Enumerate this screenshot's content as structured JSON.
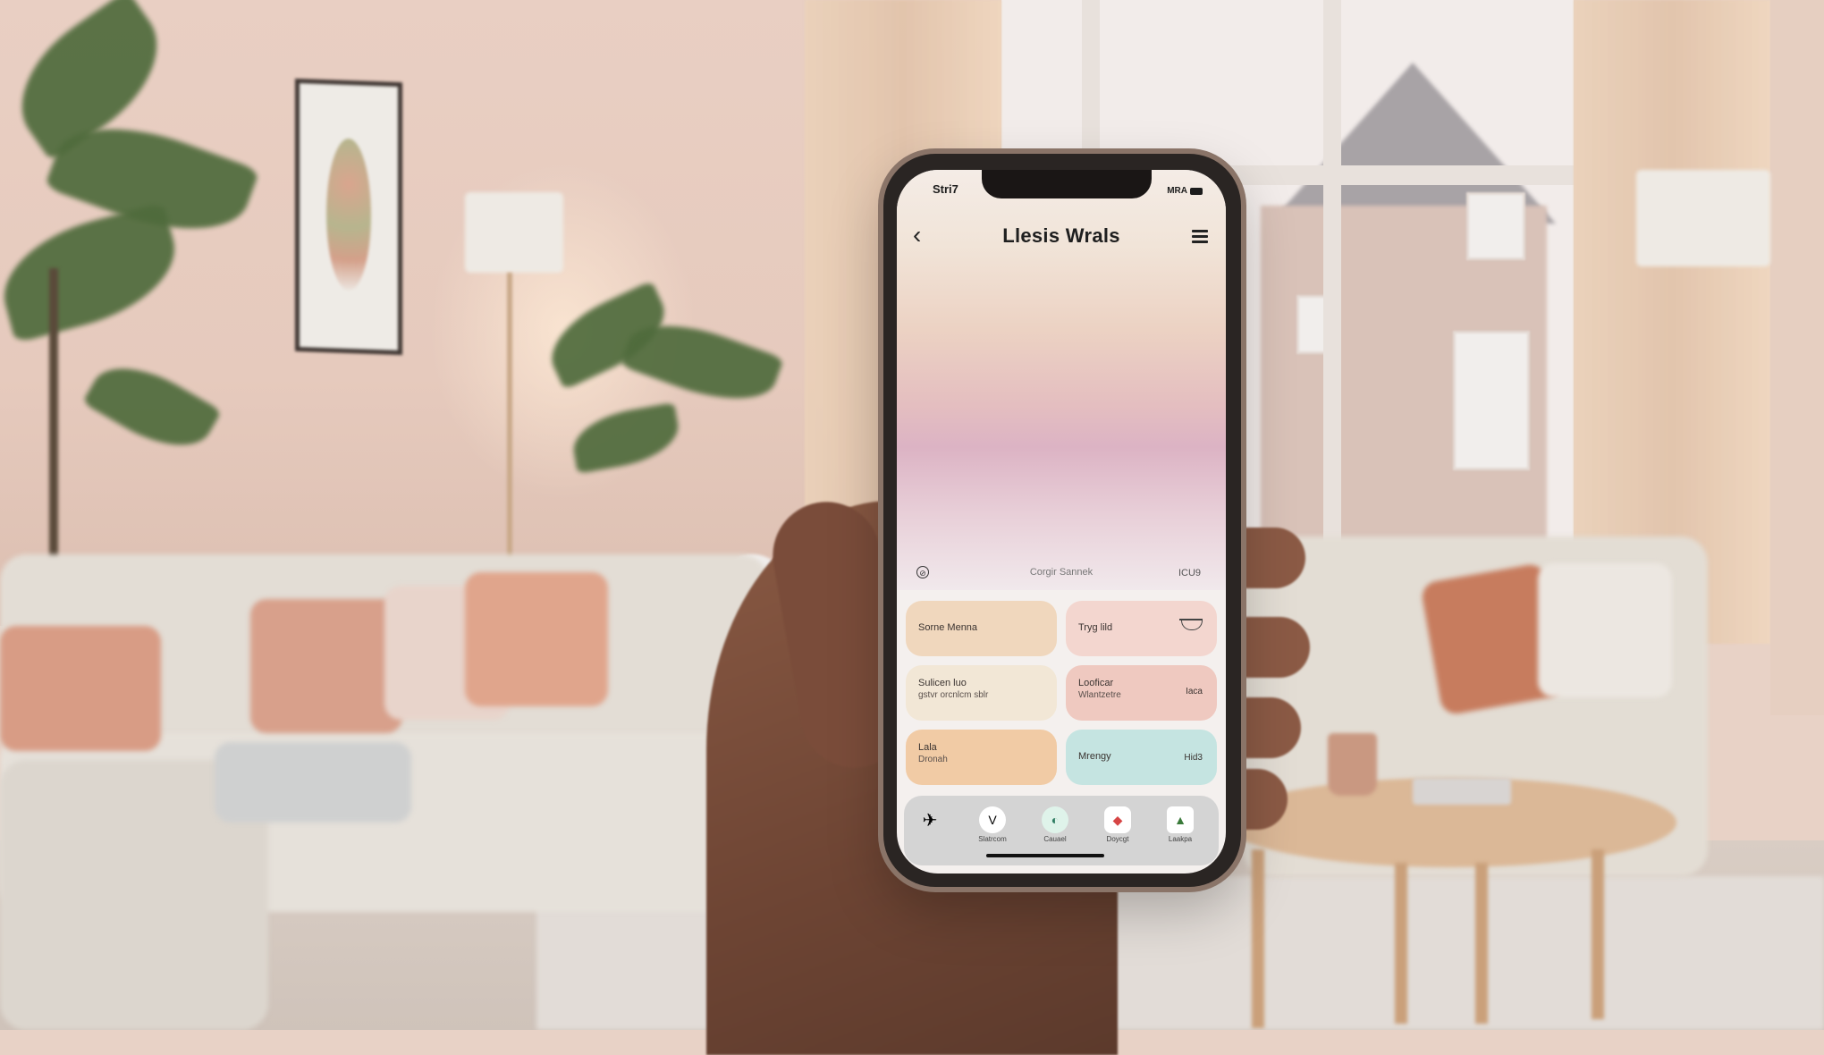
{
  "scene": {
    "description": "Hand holding smartphone in a pastel living room",
    "colors": {
      "wall": "#e8cfc3",
      "phone_frame": "#2a2523",
      "accent_pink": "#dcb3c4",
      "accent_peach": "#f0d4b8"
    }
  },
  "phone": {
    "status_bar": {
      "time": "Stri7",
      "right_text": "MRA",
      "battery_icon": "battery-icon"
    },
    "header": {
      "back_icon": "chevron-left-icon",
      "back_glyph": "‹",
      "title": "Llesis Wrals",
      "menu_icon": "hamburger-menu-icon"
    },
    "info_row": {
      "icon_glyph": "⊘",
      "center_text": "Corgir Sannek",
      "right_text": "ICU9"
    },
    "cards": [
      {
        "line1": "Sorne Menna",
        "line2": "",
        "right": "",
        "color": "#f0d7bd",
        "icon": ""
      },
      {
        "line1": "Tryg lild",
        "line2": "",
        "right": "",
        "color": "#f3d6cf",
        "icon": "bowl-icon"
      },
      {
        "line1": "Sulicen luo",
        "line2": "gstvr orcnlcm sblr",
        "right": "",
        "color": "#f2e7d6",
        "icon": ""
      },
      {
        "line1": "Looficar",
        "line2": "Wlantzetre",
        "right": "Iaca",
        "color": "#efc9c0",
        "icon": ""
      },
      {
        "line1": "Lala",
        "line2": "Dronah",
        "right": "",
        "color": "#f1cba5",
        "icon": ""
      },
      {
        "line1": "Mrengy",
        "line2": "",
        "right": "Hid3",
        "color": "#c5e4e1",
        "icon": ""
      }
    ],
    "dock": [
      {
        "label": "",
        "glyph": "✈",
        "icon": "bird-app-icon"
      },
      {
        "label": "Slatrcom",
        "glyph": "V",
        "icon": "check-app-icon"
      },
      {
        "label": "Cauael",
        "glyph": "◐",
        "icon": "leaf-app-icon"
      },
      {
        "label": "Doycgt",
        "glyph": "◆",
        "icon": "paper-plane-app-icon"
      },
      {
        "label": "Laakpa",
        "glyph": "▲",
        "icon": "landscape-app-icon"
      }
    ]
  }
}
